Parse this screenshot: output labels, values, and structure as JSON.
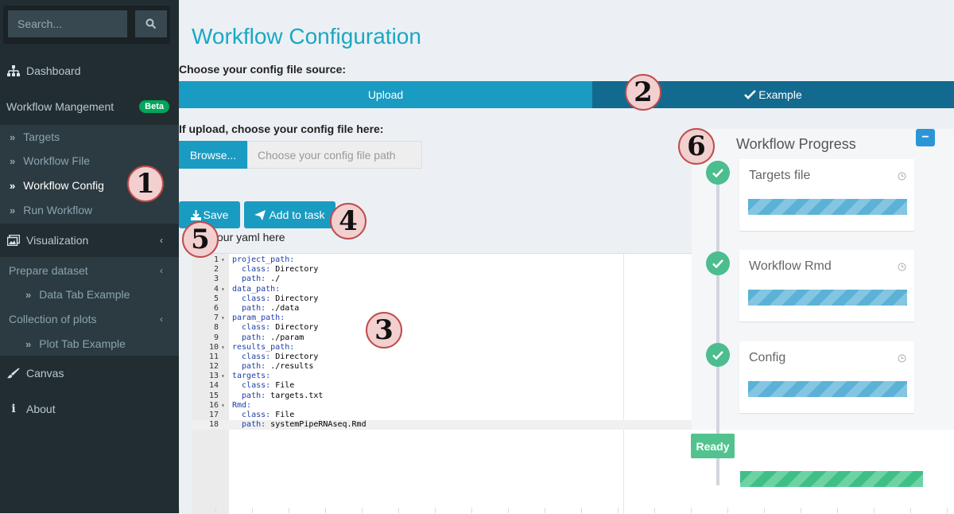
{
  "sidebar": {
    "search_placeholder": "Search...",
    "dashboard": "Dashboard",
    "workflow_management": "Workflow Mangement",
    "beta_badge": "Beta",
    "workflow_items": [
      "Targets",
      "Workflow File",
      "Workflow Config",
      "Run Workflow"
    ],
    "visualization": "Visualization",
    "prepare_dataset": "Prepare dataset",
    "data_tab_example": "Data Tab Example",
    "collection_of_plots": "Collection of plots",
    "plot_tab_example": "Plot Tab Example",
    "canvas": "Canvas",
    "about": "About"
  },
  "main": {
    "title": "Workflow Configuration",
    "source_label": "Choose your config file source:",
    "source_options": {
      "upload": "Upload",
      "example": "Example"
    },
    "upload_label": "If upload, choose your config file here:",
    "browse_button": "Browse...",
    "file_placeholder": "Choose your config file path",
    "save_button": "Save",
    "add_to_task_button": "Add to task",
    "yaml_hint": "our yaml here"
  },
  "editor": {
    "lines": [
      {
        "n": "1",
        "fold": true,
        "key": "project_path:",
        "val": ""
      },
      {
        "n": "2",
        "fold": false,
        "key": "  class:",
        "val": " Directory"
      },
      {
        "n": "3",
        "fold": false,
        "key": "  path:",
        "val": " ./"
      },
      {
        "n": "4",
        "fold": true,
        "key": "data_path:",
        "val": ""
      },
      {
        "n": "5",
        "fold": false,
        "key": "  class:",
        "val": " Directory"
      },
      {
        "n": "6",
        "fold": false,
        "key": "  path:",
        "val": " ./data"
      },
      {
        "n": "7",
        "fold": true,
        "key": "param_path:",
        "val": ""
      },
      {
        "n": "8",
        "fold": false,
        "key": "  class:",
        "val": " Directory"
      },
      {
        "n": "9",
        "fold": false,
        "key": "  path:",
        "val": " ./param"
      },
      {
        "n": "10",
        "fold": true,
        "key": "results_path:",
        "val": ""
      },
      {
        "n": "11",
        "fold": false,
        "key": "  class:",
        "val": " Directory"
      },
      {
        "n": "12",
        "fold": false,
        "key": "  path:",
        "val": " ./results"
      },
      {
        "n": "13",
        "fold": true,
        "key": "targets:",
        "val": ""
      },
      {
        "n": "14",
        "fold": false,
        "key": "  class:",
        "val": " File"
      },
      {
        "n": "15",
        "fold": false,
        "key": "  path:",
        "val": " targets.txt"
      },
      {
        "n": "16",
        "fold": true,
        "key": "Rmd:",
        "val": ""
      },
      {
        "n": "17",
        "fold": false,
        "key": "  class:",
        "val": " File"
      },
      {
        "n": "18",
        "fold": false,
        "key": "  path:",
        "val": " systemPipeRNAseq.Rmd"
      }
    ]
  },
  "progress": {
    "title": "Workflow Progress",
    "minus": "−",
    "steps": [
      "Targets file",
      "Workflow Rmd",
      "Config"
    ],
    "ready": "Ready"
  },
  "callouts": [
    "1",
    "2",
    "3",
    "4",
    "5",
    "6"
  ],
  "colors": {
    "accent": "#1a9bc2",
    "dark_accent": "#136a8f",
    "sidebar_bg": "#222d32",
    "success": "#4cbd8e"
  }
}
